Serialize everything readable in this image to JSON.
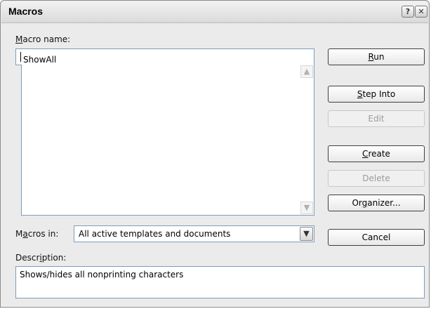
{
  "window": {
    "title": "Macros",
    "help_glyph": "?",
    "close_glyph": "✕"
  },
  "macro_name": {
    "label_key": "M",
    "label_rest": "acro name:",
    "value": "ShowAll"
  },
  "scroll": {
    "up": "▲",
    "down": "▼"
  },
  "buttons": {
    "run_key": "R",
    "run_rest": "un",
    "step_into_key": "S",
    "step_into_rest": "tep Into",
    "edit": "Edit",
    "create_key": "C",
    "create_rest": "reate",
    "delete": "Delete",
    "organizer_pre": "Or",
    "organizer_key": "g",
    "organizer_rest": "anizer...",
    "cancel": "Cancel"
  },
  "macros_in": {
    "label_pre": "M",
    "label_key": "a",
    "label_rest": "cros in:",
    "value": "All active templates and documents",
    "arrow": "▼"
  },
  "description": {
    "label_pre": "Descr",
    "label_key": "i",
    "label_rest": "ption:",
    "value": "Shows/hides all nonprinting characters"
  }
}
